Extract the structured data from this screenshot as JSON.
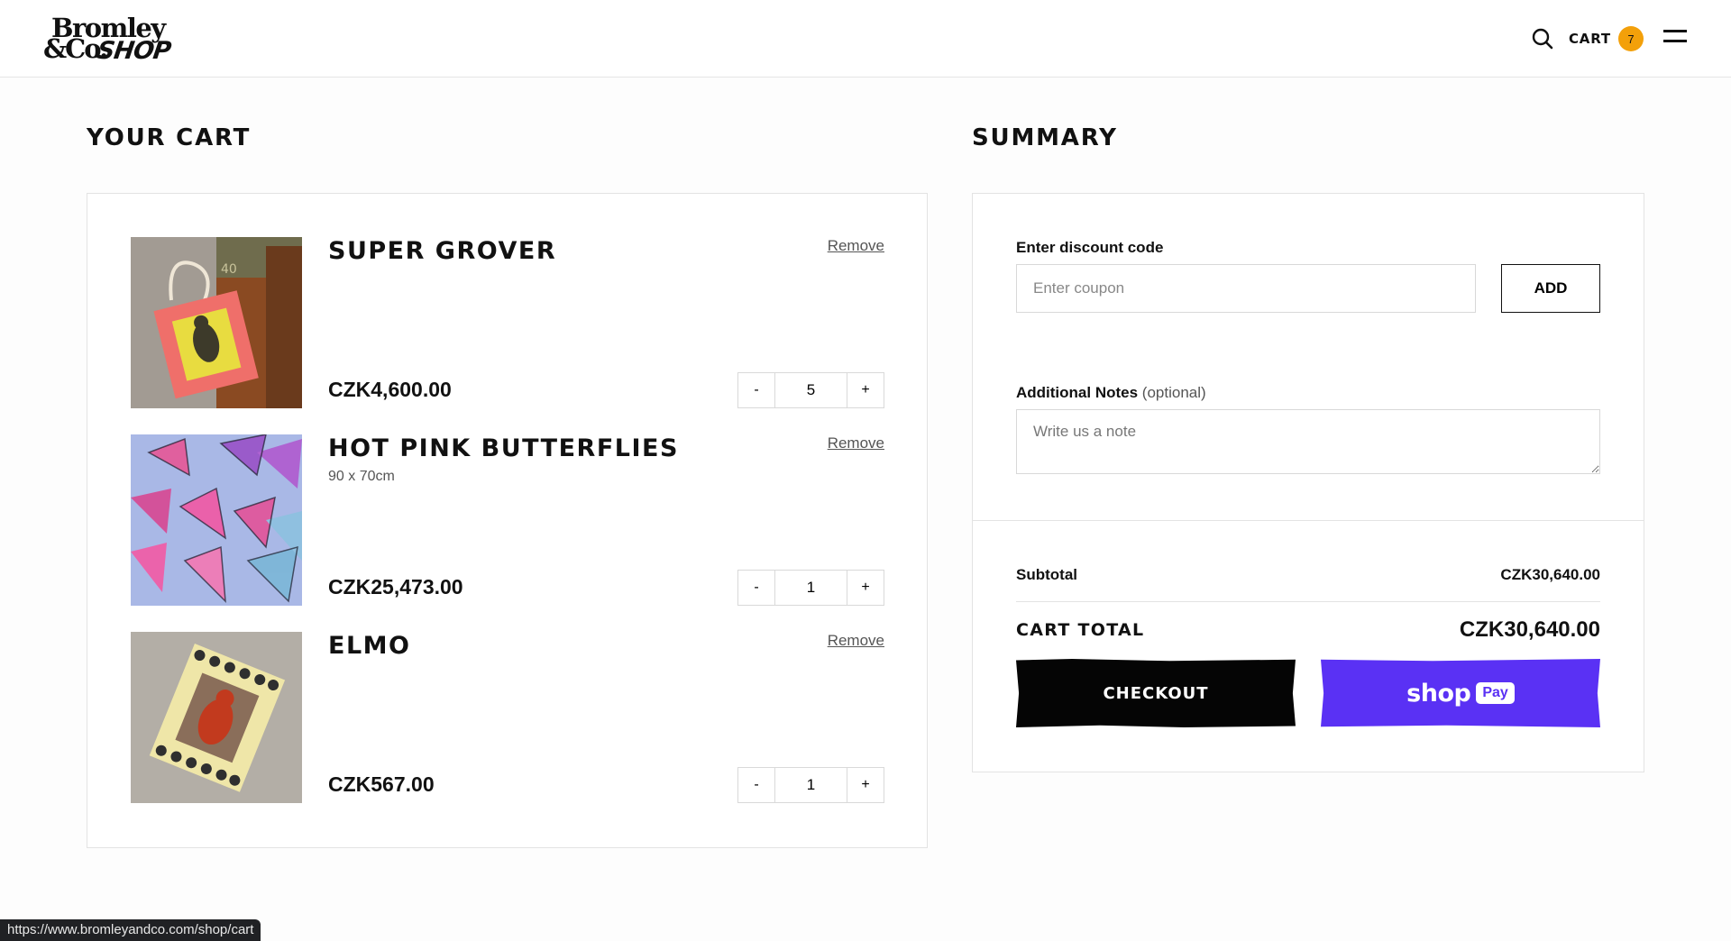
{
  "header": {
    "logo": {
      "line1": "Bromley",
      "line2": "&Co.",
      "line3": "SHOP"
    },
    "cart_label": "CART",
    "cart_count": "7"
  },
  "cart": {
    "title": "YOUR CART",
    "items": [
      {
        "name": "SUPER GROVER",
        "variant": "",
        "price": "CZK4,600.00",
        "quantity": "5",
        "remove_label": "Remove"
      },
      {
        "name": "HOT PINK BUTTERFLIES",
        "variant": "90 x 70cm",
        "price": "CZK25,473.00",
        "quantity": "1",
        "remove_label": "Remove"
      },
      {
        "name": "ELMO",
        "variant": "",
        "price": "CZK567.00",
        "quantity": "1",
        "remove_label": "Remove"
      }
    ],
    "qty_minus": "-",
    "qty_plus": "+"
  },
  "summary": {
    "title": "SUMMARY",
    "discount_label": "Enter discount code",
    "coupon_placeholder": "Enter coupon",
    "add_label": "ADD",
    "notes_label": "Additional Notes",
    "notes_optional": "(optional)",
    "notes_placeholder": "Write us a note",
    "subtotal_label": "Subtotal",
    "subtotal_value": "CZK30,640.00",
    "total_label": "CART TOTAL",
    "total_value": "CZK30,640.00",
    "checkout_label": "CHECKOUT",
    "shoppay_word": "shop",
    "shoppay_pay": "Pay"
  },
  "status_bar": {
    "url": "https://www.bromleyandco.com/shop/cart"
  },
  "colors": {
    "accent_badge": "#f3a00a",
    "shoppay": "#5a31f4",
    "checkout": "#050505"
  },
  "icons": [
    "search-icon",
    "menu-icon"
  ]
}
